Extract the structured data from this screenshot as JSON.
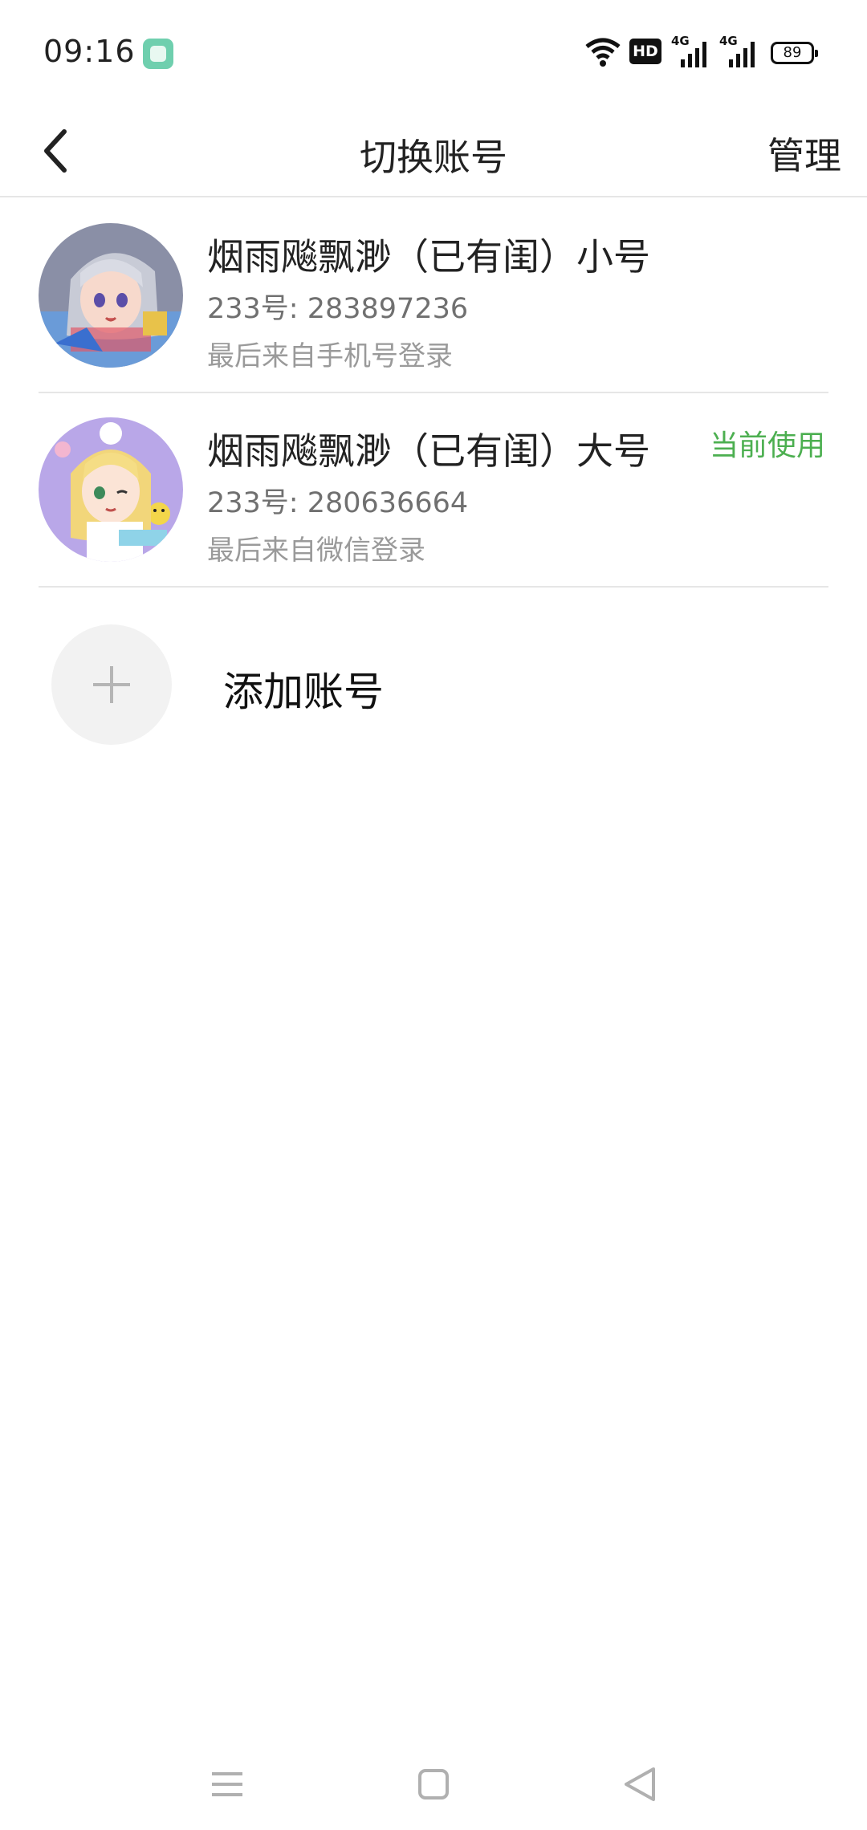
{
  "status_bar": {
    "time": "09:16",
    "battery": "89",
    "hd_label": "HD",
    "network_1": "4G",
    "network_2": "4G"
  },
  "header": {
    "title": "切换账号",
    "manage_label": "管理"
  },
  "accounts": [
    {
      "name": "烟雨飚飘渺（已有闺）小号",
      "id_text": "233号: 283897236",
      "login_text": "最后来自手机号登录",
      "current": false,
      "avatar_icon": "anime-avatar-silver-hair"
    },
    {
      "name": "烟雨飚飘渺（已有闺）大号",
      "id_text": "233号: 280636664",
      "login_text": "最后来自微信登录",
      "current": true,
      "current_label": "当前使用",
      "avatar_icon": "anime-avatar-blonde-hair"
    }
  ],
  "add_account": {
    "label": "添加账号",
    "icon": "plus-icon"
  },
  "colors": {
    "accent_green": "#4caf50",
    "divider": "#e6e6e6"
  }
}
